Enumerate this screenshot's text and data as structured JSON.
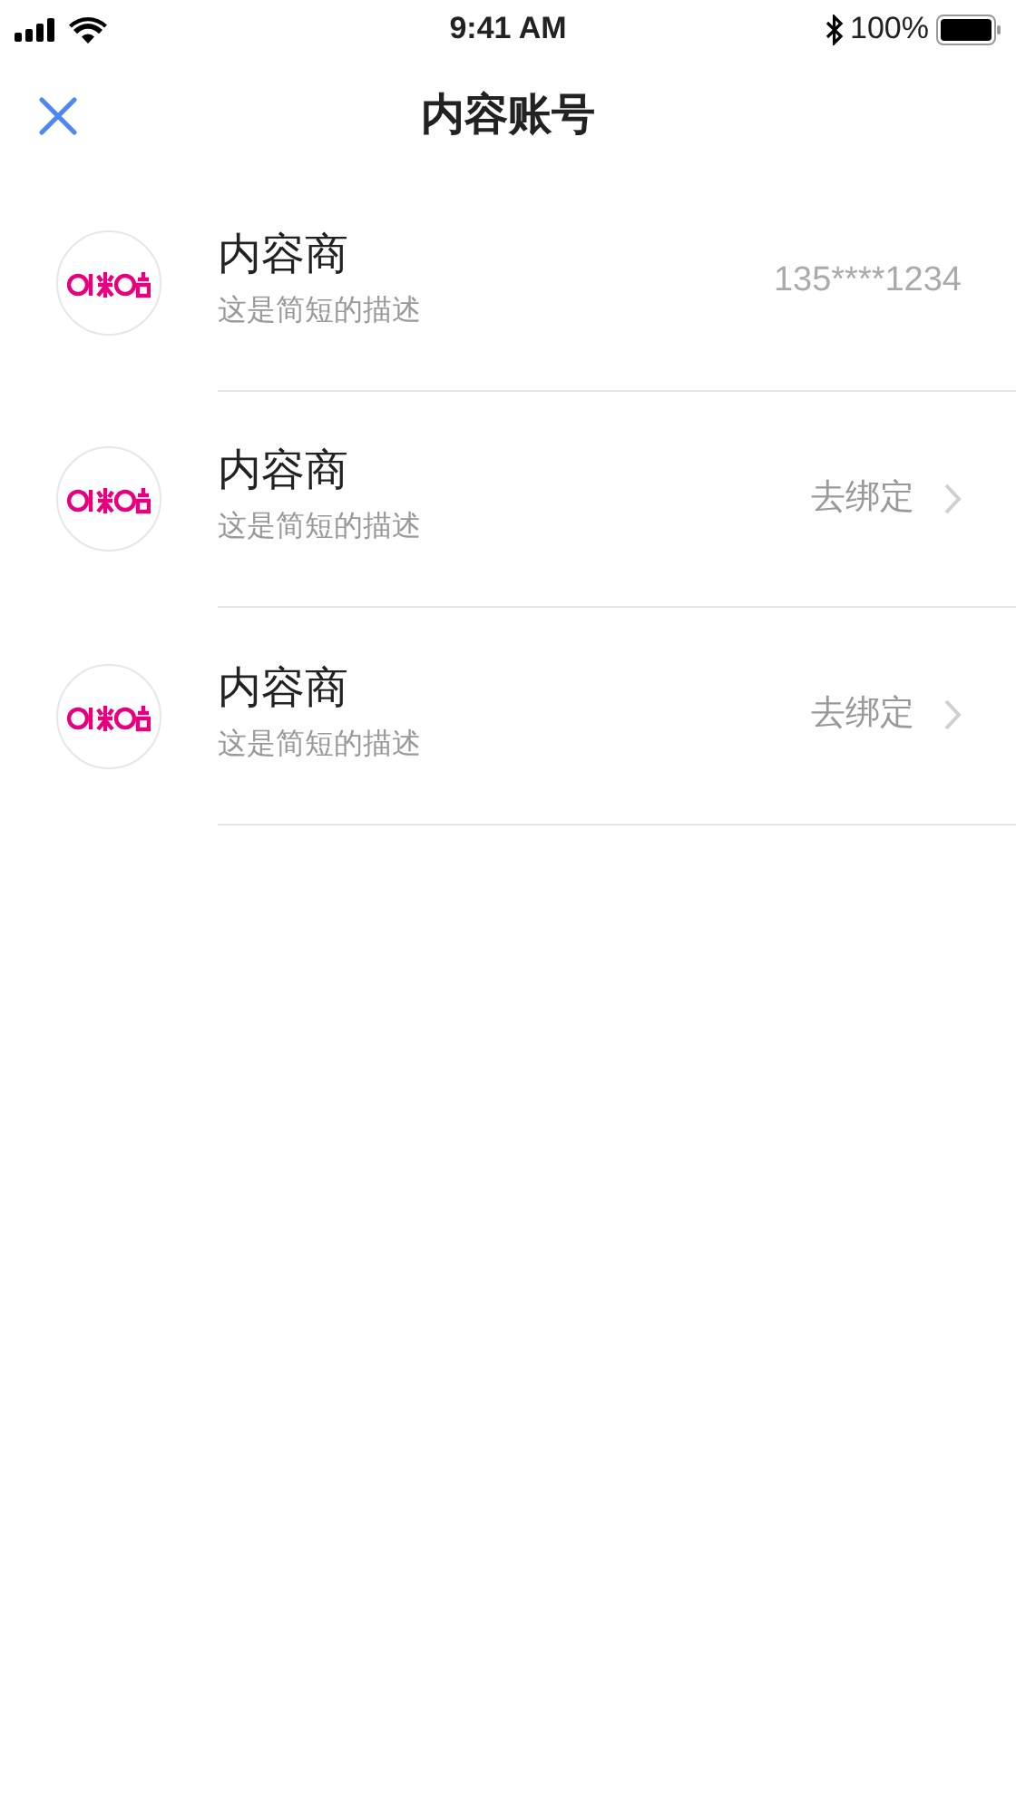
{
  "status_bar": {
    "time": "9:41 AM",
    "battery": "100%"
  },
  "nav": {
    "title": "内容账号"
  },
  "accounts": [
    {
      "name": "内容商",
      "description": "这是简短的描述",
      "kind": "phone",
      "value": "135****1234"
    },
    {
      "name": "内容商",
      "description": "这是简短的描述",
      "kind": "action",
      "value": "去绑定"
    },
    {
      "name": "内容商",
      "description": "这是简短的描述",
      "kind": "action",
      "value": "去绑定"
    }
  ]
}
